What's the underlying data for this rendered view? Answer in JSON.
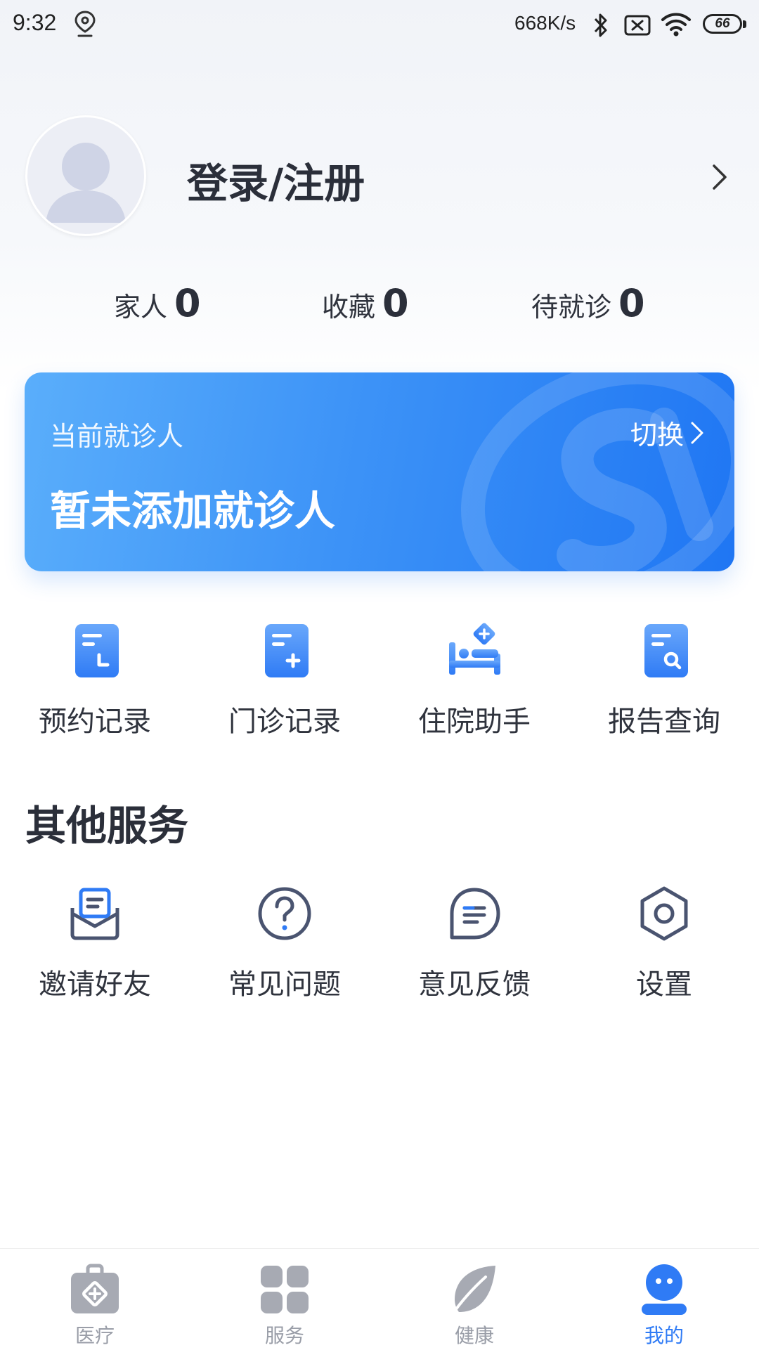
{
  "status_bar": {
    "time": "9:32",
    "speed": "668K/s",
    "battery": "66"
  },
  "profile": {
    "login_label": "登录/注册"
  },
  "stats": [
    {
      "label": "家人",
      "value": "0"
    },
    {
      "label": "收藏",
      "value": "0"
    },
    {
      "label": "待就诊",
      "value": "0"
    }
  ],
  "patient_card": {
    "label": "当前就诊人",
    "switch_label": "切换",
    "patient": "暂未添加就诊人"
  },
  "quick_entries": [
    {
      "label": "预约记录",
      "icon": "appointment-record-icon"
    },
    {
      "label": "门诊记录",
      "icon": "outpatient-record-icon"
    },
    {
      "label": "住院助手",
      "icon": "hospital-bed-icon"
    },
    {
      "label": "报告查询",
      "icon": "report-search-icon"
    }
  ],
  "other_services": {
    "title": "其他服务",
    "items": [
      {
        "label": "邀请好友",
        "icon": "invite-mail-icon"
      },
      {
        "label": "常见问题",
        "icon": "question-icon"
      },
      {
        "label": "意见反馈",
        "icon": "feedback-icon"
      },
      {
        "label": "设置",
        "icon": "settings-icon"
      }
    ]
  },
  "bottom_nav": [
    {
      "label": "医疗",
      "icon": "medical-kit-icon"
    },
    {
      "label": "服务",
      "icon": "grid-icon"
    },
    {
      "label": "健康",
      "icon": "leaf-icon"
    },
    {
      "label": "我的",
      "icon": "profile-face-icon",
      "active": true
    }
  ],
  "colors": {
    "accent": "#2f7bf5",
    "card_start": "#5aaefb",
    "card_end": "#1f76f3",
    "text_primary": "#2b2f3a",
    "nav_inactive": "#9a9ea8"
  }
}
